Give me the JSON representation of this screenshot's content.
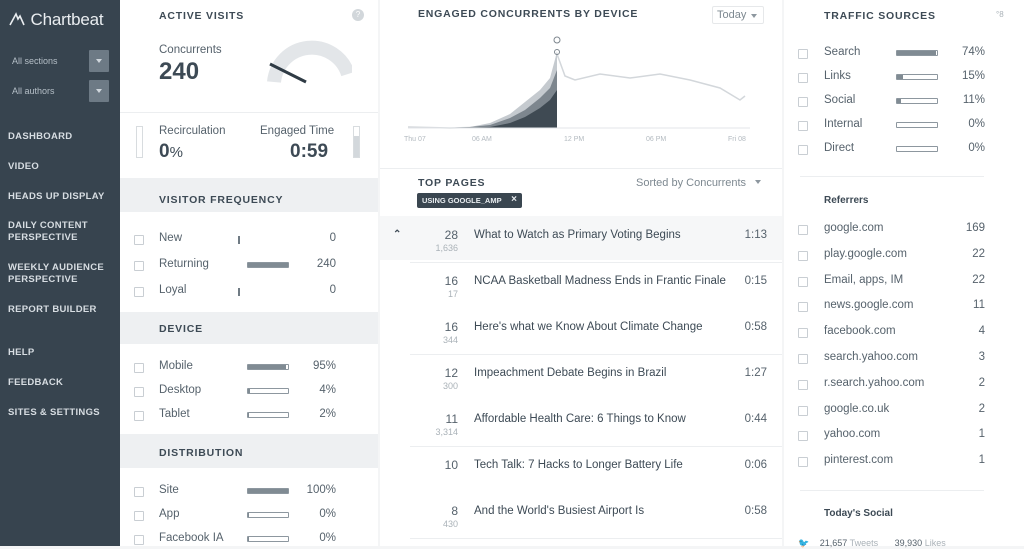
{
  "sidebar": {
    "logo": "Chartbeat",
    "filters": [
      "All sections",
      "All authors"
    ],
    "nav": [
      "DASHBOARD",
      "VIDEO",
      "HEADS UP DISPLAY",
      "DAILY CONTENT PERSPECTIVE",
      "WEEKLY AUDIENCE PERSPECTIVE",
      "REPORT BUILDER"
    ],
    "nav2": [
      "HELP",
      "FEEDBACK",
      "SITES & SETTINGS"
    ]
  },
  "active_visits": {
    "title": "ACTIVE VISITS",
    "help": "?",
    "concurrents_label": "Concurrents",
    "concurrents_value": "240",
    "recirculation_label": "Recirculation",
    "recirculation_value": "0",
    "recirculation_unit": "%",
    "engaged_label": "Engaged Time",
    "engaged_value": "0:59"
  },
  "visitor_frequency": {
    "title": "VISITOR FREQUENCY",
    "rows": [
      {
        "label": "New",
        "value": "0",
        "fill": 0
      },
      {
        "label": "Returning",
        "value": "240",
        "fill": 1
      },
      {
        "label": "Loyal",
        "value": "0",
        "fill": 0
      }
    ]
  },
  "device": {
    "title": "DEVICE",
    "rows": [
      {
        "label": "Mobile",
        "value": "95%",
        "fill": 0.95
      },
      {
        "label": "Desktop",
        "value": "4%",
        "fill": 0.04
      },
      {
        "label": "Tablet",
        "value": "2%",
        "fill": 0.02
      }
    ]
  },
  "distribution": {
    "title": "DISTRIBUTION",
    "rows": [
      {
        "label": "Site",
        "value": "100%",
        "fill": 1
      },
      {
        "label": "App",
        "value": "0%",
        "fill": 0
      },
      {
        "label": "Facebook IA",
        "value": "0%",
        "fill": 0
      }
    ]
  },
  "engaged_chart": {
    "title": "ENGAGED CONCURRENTS BY DEVICE",
    "range_label": "Today",
    "x_ticks": [
      "Thu 07",
      "06 AM",
      "12 PM",
      "06 PM",
      "Fri 08"
    ]
  },
  "top_pages": {
    "title": "TOP PAGES",
    "sort_label": "Sorted by Concurrents",
    "filter_tag": "USING GOOGLE_AMP",
    "filter_close": "×",
    "rows": [
      {
        "rank_icon": "⌃",
        "concurrents": "28",
        "sub": "1,636",
        "title": "What to Watch as Primary Voting Begins",
        "time": "1:13"
      },
      {
        "rank_icon": "",
        "concurrents": "16",
        "sub": "17",
        "title": "NCAA Basketball Madness Ends in Frantic Finale",
        "time": "0:15"
      },
      {
        "rank_icon": "",
        "concurrents": "16",
        "sub": "344",
        "title": "Here's what we Know About Climate Change",
        "time": "0:58"
      },
      {
        "rank_icon": "",
        "concurrents": "12",
        "sub": "300",
        "title": "Impeachment Debate Begins in Brazil",
        "time": "1:27"
      },
      {
        "rank_icon": "",
        "concurrents": "11",
        "sub": "3,314",
        "title": "Affordable Health Care: 6 Things to Know",
        "time": "0:44"
      },
      {
        "rank_icon": "",
        "concurrents": "10",
        "sub": "",
        "title": "Tech Talk: 7 Hacks to Longer Battery Life",
        "time": "0:06"
      },
      {
        "rank_icon": "",
        "concurrents": "8",
        "sub": "430",
        "title": "And the World's Busiest Airport Is",
        "time": "0:58"
      }
    ]
  },
  "traffic_sources": {
    "title": "TRAFFIC SOURCES",
    "corner": "°8",
    "rows": [
      {
        "label": "Search",
        "value": "74%",
        "fill": 0.98
      },
      {
        "label": "Links",
        "value": "15%",
        "fill": 0.15
      },
      {
        "label": "Social",
        "value": "11%",
        "fill": 0.11
      },
      {
        "label": "Internal",
        "value": "0%",
        "fill": 0
      },
      {
        "label": "Direct",
        "value": "0%",
        "fill": 0
      }
    ]
  },
  "referrers": {
    "title": "Referrers",
    "rows": [
      {
        "label": "google.com",
        "value": "169"
      },
      {
        "label": "play.google.com",
        "value": "22"
      },
      {
        "label": "Email, apps, IM",
        "value": "22"
      },
      {
        "label": "news.google.com",
        "value": "11"
      },
      {
        "label": "facebook.com",
        "value": "4"
      },
      {
        "label": "search.yahoo.com",
        "value": "3"
      },
      {
        "label": "r.search.yahoo.com",
        "value": "2"
      },
      {
        "label": "google.co.uk",
        "value": "2"
      },
      {
        "label": "yahoo.com",
        "value": "1"
      },
      {
        "label": "pinterest.com",
        "value": "1"
      }
    ]
  },
  "todays_social": {
    "title": "Today's Social",
    "tweets_value": "21,657",
    "tweets_label": "Tweets",
    "likes_value": "39,930",
    "likes_label": "Likes"
  }
}
